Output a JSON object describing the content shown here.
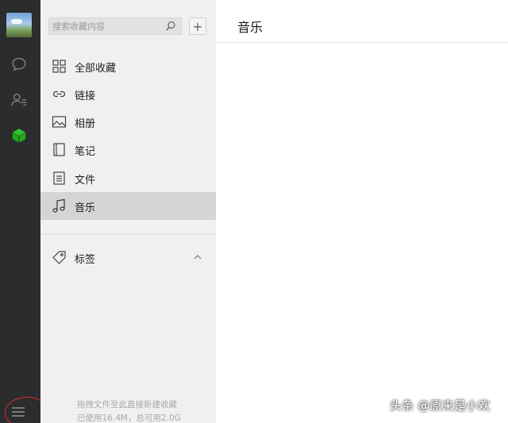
{
  "rail": {
    "icons": [
      "avatar",
      "chat-bubble-icon",
      "contacts-icon",
      "favorites-cube-icon",
      "menu-icon"
    ],
    "active_color": "#1aad19"
  },
  "panel": {
    "search_placeholder": "搜索收藏内容",
    "add_label": "+",
    "nav": [
      {
        "label": "全部收藏",
        "icon": "grid-icon"
      },
      {
        "label": "链接",
        "icon": "link-icon"
      },
      {
        "label": "相册",
        "icon": "image-icon"
      },
      {
        "label": "笔记",
        "icon": "notebook-icon"
      },
      {
        "label": "文件",
        "icon": "file-icon"
      },
      {
        "label": "音乐",
        "icon": "music-icon",
        "active": true
      }
    ],
    "tags_label": "标签",
    "footer_hint": "拖拽文件至此直接新建收藏",
    "footer_usage": "已使用16.4M，总可用2.0G"
  },
  "content": {
    "title": "音乐"
  },
  "watermark": "头条 @原来是小欢"
}
